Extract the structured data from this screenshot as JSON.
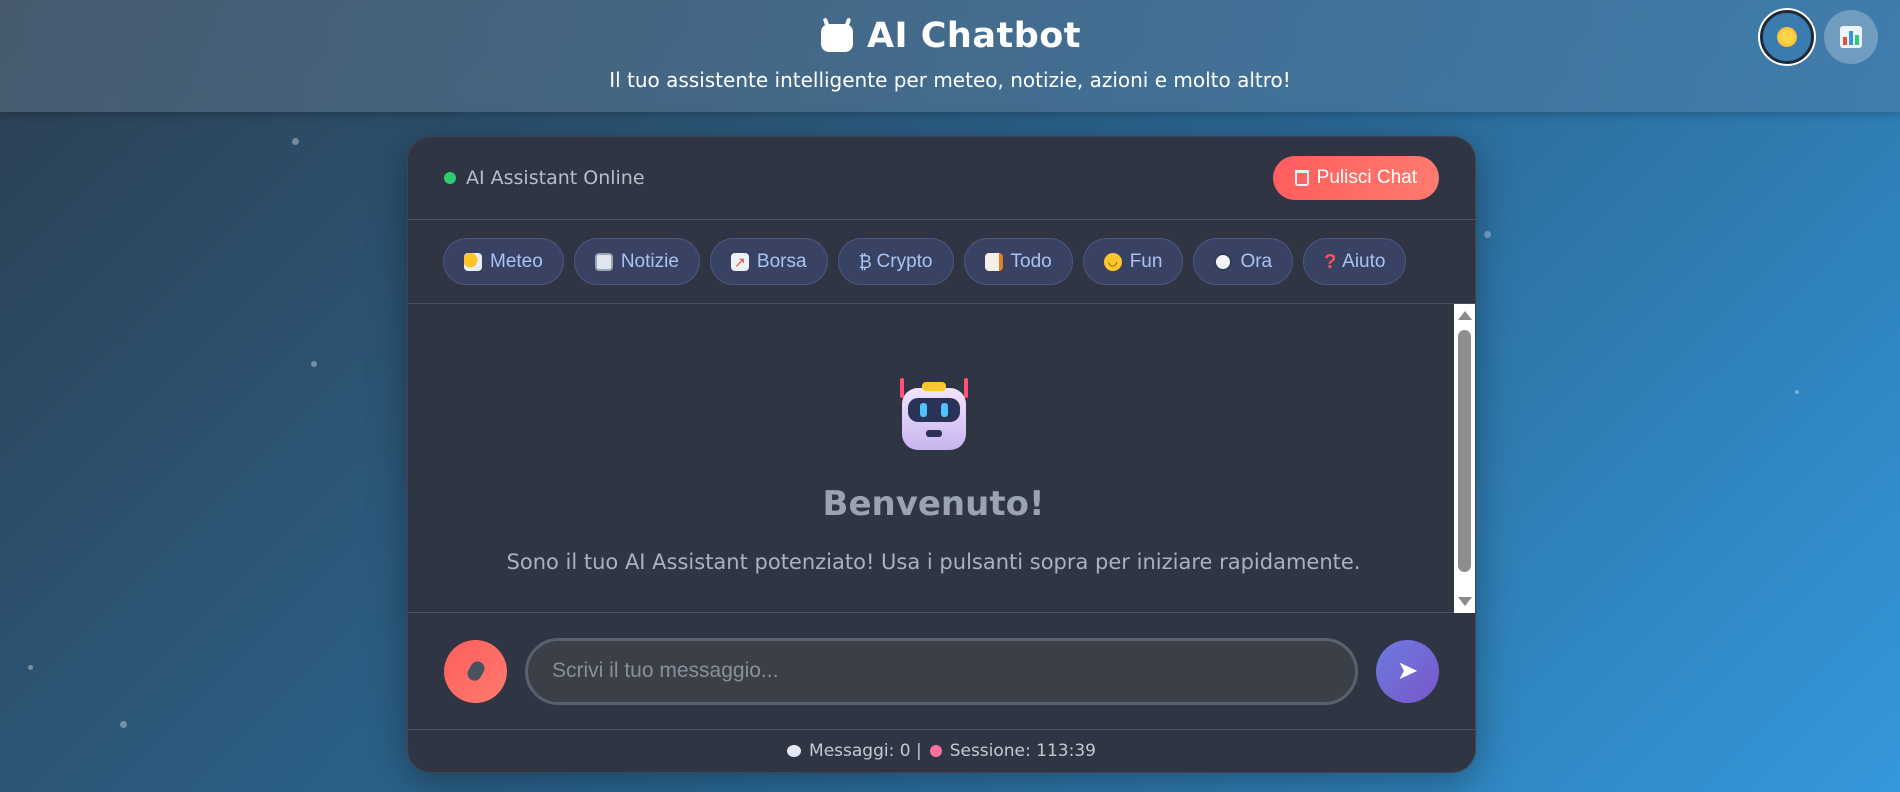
{
  "header": {
    "title": "AI Chatbot",
    "subtitle": "Il tuo assistente intelligente per meteo, notizie, azioni e molto altro!",
    "title_icon": "robot-icon",
    "theme_toggle_icon": "sun-icon",
    "stats_icon": "bar-chart-icon"
  },
  "chat": {
    "status_text": "AI Assistant Online",
    "status_color": "#2ecc71",
    "clear_label": "Pulisci Chat",
    "quick_actions": [
      {
        "label": "Meteo",
        "icon": "weather-icon"
      },
      {
        "label": "Notizie",
        "icon": "newspaper-icon"
      },
      {
        "label": "Borsa",
        "icon": "chart-up-icon"
      },
      {
        "label": "Crypto",
        "icon": "bitcoin-icon"
      },
      {
        "label": "Todo",
        "icon": "memo-icon"
      },
      {
        "label": "Fun",
        "icon": "laughing-face-icon"
      },
      {
        "label": "Ora",
        "icon": "clock-icon"
      },
      {
        "label": "Aiuto",
        "icon": "question-icon"
      }
    ],
    "welcome": {
      "title": "Benvenuto!",
      "text": "Sono il tuo AI Assistant potenziato! Usa i pulsanti sopra per iniziare rapidamente."
    },
    "input_placeholder": "Scrivi il tuo messaggio...",
    "input_value": "",
    "footer": {
      "messages_label": "Messaggi: 0 |",
      "session_label": "Sessione: 113:39"
    }
  },
  "colors": {
    "accent_red": "#ff5e5e",
    "accent_purple": "#7a55c9",
    "panel_bg": "#2f3542",
    "quick_btn_text": "#a9c3f5"
  }
}
